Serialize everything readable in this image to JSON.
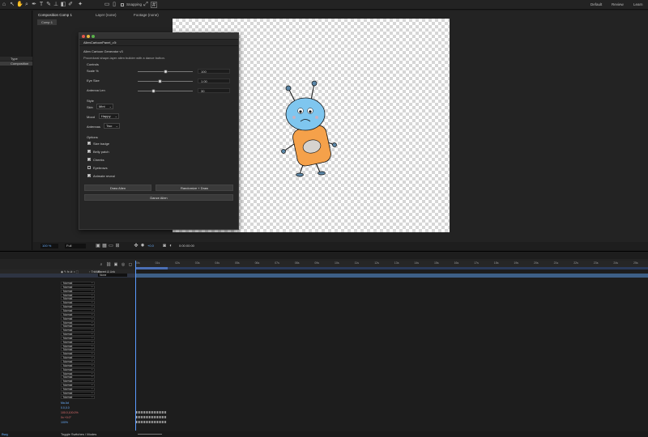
{
  "workspaces": [
    "Default",
    "Review",
    "Learn"
  ],
  "toolbar": {
    "snapping_label": "Snapping"
  },
  "comp_tabs": [
    "Composition Comp 1",
    "Layer (none)",
    "Footage (none)"
  ],
  "comp_subtab": "Comp 1",
  "left_panel": {
    "type_header": "Type",
    "item_label": "Composition"
  },
  "viewer": {
    "zoom": "100 %",
    "quality": "Full",
    "exposure": "+0.0",
    "timecode": "0:00:00:00"
  },
  "panel": {
    "title": "AlienCartoonPanel_v3",
    "heading": "Alien Cartoon Generator v3",
    "desc": "Procedural shape-layer alien builder with a dance button.",
    "controls_label": "Controls",
    "sliders": [
      {
        "label": "Scale %",
        "value": "100"
      },
      {
        "label": "Eye Size",
        "value": "1.00"
      },
      {
        "label": "Antenna Len",
        "value": "30"
      }
    ],
    "slider_levels": [
      0.5,
      0.4,
      0.28
    ],
    "style_label": "Style",
    "dropdowns": [
      {
        "label": "Skin",
        "value": "Mint"
      },
      {
        "label": "Mood",
        "value": "Happy"
      },
      {
        "label": "Antennas",
        "value": "Two"
      }
    ],
    "options_label": "Options",
    "options": [
      {
        "label": "Size badge",
        "checked": true
      },
      {
        "label": "Belly patch",
        "checked": true
      },
      {
        "label": "Cheeks",
        "checked": true
      },
      {
        "label": "Eyebrows",
        "checked": false
      },
      {
        "label": "Animate reveal",
        "checked": true
      }
    ],
    "buttons": {
      "draw": "Draw Alien",
      "randomize": "Randomize + Draw",
      "dance": "Dance Alien"
    }
  },
  "timeline": {
    "parent_header": "Parent & Link",
    "mode_label": "Normal",
    "parent_value": "None",
    "track_matte_header": "↑ TrkMat",
    "ruler_ticks": [
      "00s",
      "01s",
      "02s",
      "03s",
      "04s",
      "05s",
      "06s",
      "07s",
      "08s",
      "09s",
      "10s",
      "11s",
      "12s",
      "13s",
      "14s",
      "15s",
      "16s",
      "17s",
      "18s",
      "19s",
      "20s",
      "21s",
      "22s",
      "23s",
      "24s",
      "25s"
    ],
    "props": [
      "Ma Ad",
      "0.0,0.0",
      "100.0,100.0%",
      "0x +0.0°",
      "100%"
    ],
    "toggle_label": "Toggle Switches / Modes",
    "bottom_label": "Bwg"
  },
  "colors": {
    "alien_head": "#7fc6ef",
    "alien_body": "#f5a14a",
    "antenna_tip": "#5b87a8"
  }
}
